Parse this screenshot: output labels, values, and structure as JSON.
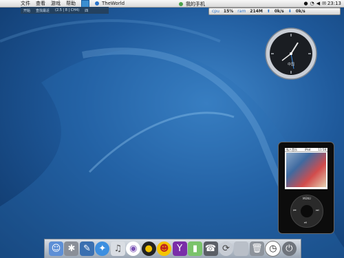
{
  "menubar": {
    "apple_glyph": "",
    "items": [
      "文件",
      "查看",
      "游戏",
      "帮助"
    ],
    "taskbar_items": [
      "TheWorld",
      "我的手机"
    ],
    "clock": "23:13"
  },
  "dropdown": {
    "items": [
      "开始",
      "查找最近",
      "(2.5 | 8 | CH4)",
      "四"
    ]
  },
  "monitor": {
    "cpu_label": "cpu",
    "cpu_value": "15%",
    "ram_label": "ram",
    "ram_value": "214M",
    "down_value": "0k/s",
    "up_value": "0k/s"
  },
  "clock_widget": {
    "label": "中国"
  },
  "ipod": {
    "title_left": "私人音乐",
    "title_center": "iPod",
    "title_right": "11:58",
    "wheel_menu": "MENU"
  },
  "dock": {
    "icons": [
      "finder-icon",
      "settings-icon",
      "textedit-icon",
      "safari-icon",
      "itunes-icon",
      "ipod-icon",
      "qq-penguin-icon",
      "yahoo-messenger-icon",
      "qq-yellow-icon",
      "mobile-phone-icon",
      "telephone-icon",
      "sync-icon",
      "apple-icon",
      "trash-icon",
      "clock-icon",
      "power-icon"
    ]
  }
}
